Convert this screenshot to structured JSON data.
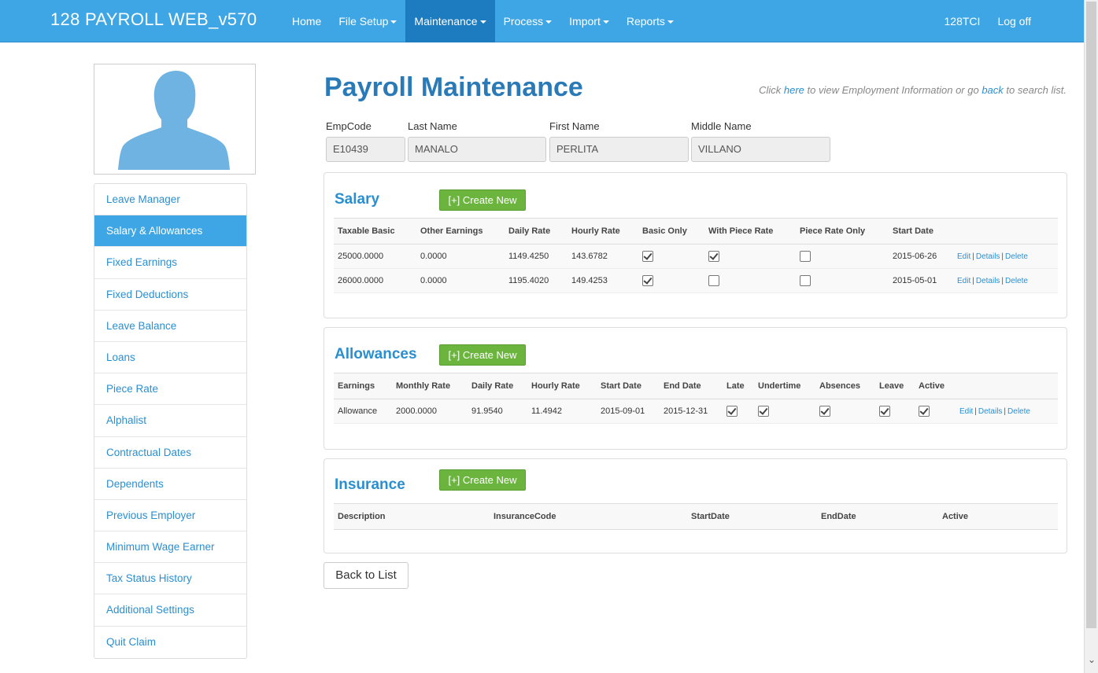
{
  "app": {
    "brand": "128 PAYROLL WEB_v570",
    "nav": [
      {
        "label": "Home",
        "dropdown": false,
        "active": false
      },
      {
        "label": "File Setup",
        "dropdown": true,
        "active": false
      },
      {
        "label": "Maintenance",
        "dropdown": true,
        "active": true
      },
      {
        "label": "Process",
        "dropdown": true,
        "active": false
      },
      {
        "label": "Import",
        "dropdown": true,
        "active": false
      },
      {
        "label": "Reports",
        "dropdown": true,
        "active": false
      }
    ],
    "user": "128TCI",
    "logoff": "Log off"
  },
  "sidebar": {
    "items": [
      {
        "label": "Leave Manager"
      },
      {
        "label": "Salary & Allowances",
        "active": true
      },
      {
        "label": "Fixed Earnings"
      },
      {
        "label": "Fixed Deductions"
      },
      {
        "label": "Leave Balance"
      },
      {
        "label": "Loans"
      },
      {
        "label": "Piece Rate"
      },
      {
        "label": "Alphalist"
      },
      {
        "label": "Contractual Dates"
      },
      {
        "label": "Dependents"
      },
      {
        "label": "Previous Employer"
      },
      {
        "label": "Minimum Wage Earner"
      },
      {
        "label": "Tax Status History"
      },
      {
        "label": "Additional Settings"
      },
      {
        "label": "Quit Claim"
      }
    ]
  },
  "page": {
    "title": "Payroll Maintenance",
    "hint_prefix": "Click ",
    "hint_here": "here",
    "hint_mid": " to view Employment Information or go ",
    "hint_back": "back",
    "hint_suffix": " to search list."
  },
  "employee": {
    "empcode_label": "EmpCode",
    "empcode": "E10439",
    "lastname_label": "Last Name",
    "lastname": "MANALO",
    "firstname_label": "First Name",
    "firstname": "PERLITA",
    "middlename_label": "Middle Name",
    "middlename": "VILLANO"
  },
  "create_new_label": "[+] Create New",
  "salary": {
    "title": "Salary",
    "columns": [
      "Taxable Basic",
      "Other Earnings",
      "Daily Rate",
      "Hourly Rate",
      "Basic Only",
      "With Piece Rate",
      "Piece Rate Only",
      "Start Date",
      ""
    ],
    "rows": [
      {
        "taxable": "25000.0000",
        "other": "0.0000",
        "daily": "1149.4250",
        "hourly": "143.6782",
        "basic_only": true,
        "with_piece": true,
        "piece_only": false,
        "start": "2015-06-26"
      },
      {
        "taxable": "26000.0000",
        "other": "0.0000",
        "daily": "1195.4020",
        "hourly": "149.4253",
        "basic_only": true,
        "with_piece": false,
        "piece_only": false,
        "start": "2015-05-01"
      }
    ]
  },
  "allowances": {
    "title": "Allowances",
    "columns": [
      "Earnings",
      "Monthly Rate",
      "Daily Rate",
      "Hourly Rate",
      "Start Date",
      "End Date",
      "Late",
      "Undertime",
      "Absences",
      "Leave",
      "Active",
      ""
    ],
    "rows": [
      {
        "earnings": "Allowance",
        "monthly": "2000.0000",
        "daily": "91.9540",
        "hourly": "11.4942",
        "start": "2015-09-01",
        "end": "2015-12-31",
        "late": true,
        "undertime": true,
        "absences": true,
        "leave": true,
        "active": true
      }
    ]
  },
  "insurance": {
    "title": "Insurance",
    "columns": [
      "Description",
      "InsuranceCode",
      "StartDate",
      "EndDate",
      "Active"
    ]
  },
  "row_links": {
    "edit": "Edit",
    "details": "Details",
    "delete": "Delete"
  },
  "back_to_list": "Back to List",
  "colors": {
    "nav": "#3ea6e4",
    "nav_active": "#1d7bbf",
    "link": "#2a8fd0",
    "button_green": "#6bb53e"
  }
}
